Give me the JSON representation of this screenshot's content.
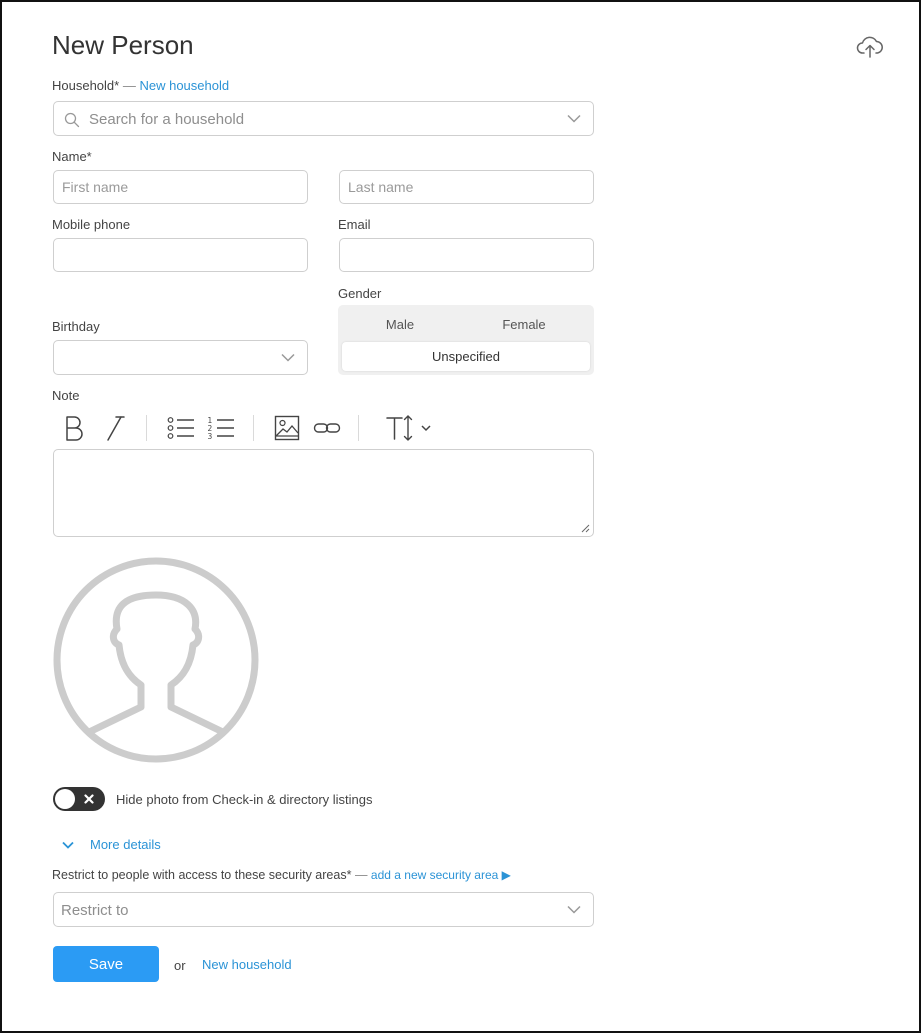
{
  "page": {
    "title": "New Person"
  },
  "household": {
    "label": "Household*",
    "separator": "—",
    "new_link": "New household",
    "placeholder": "Search for a household"
  },
  "name": {
    "label": "Name*",
    "first_placeholder": "First name",
    "last_placeholder": "Last name",
    "first_value": "",
    "last_value": ""
  },
  "contact": {
    "mobile_label": "Mobile phone",
    "email_label": "Email",
    "mobile_value": "",
    "email_value": ""
  },
  "gender": {
    "label": "Gender",
    "options": [
      "Male",
      "Female",
      "Unspecified"
    ],
    "selected": "Unspecified"
  },
  "birthday": {
    "label": "Birthday",
    "value": ""
  },
  "note": {
    "label": "Note",
    "toolbar": [
      "bold-icon",
      "italic-icon",
      "bulleted-list-icon",
      "numbered-list-icon",
      "image-icon",
      "link-icon",
      "text-size-icon"
    ]
  },
  "photo": {
    "hide_label": "Hide photo from Check-in & directory listings",
    "hide_enabled": false
  },
  "more_details": {
    "label": "More details"
  },
  "security": {
    "label": "Restrict to people with access to these security areas*",
    "separator": "—",
    "add_link": "add a new security area ▶",
    "placeholder": "Restrict to"
  },
  "actions": {
    "save_label": "Save",
    "or_text": "or",
    "new_household_link": "New household"
  },
  "colors": {
    "accent": "#2b93d6",
    "save_button": "#2b9bf4",
    "toggle_off": "#333333",
    "avatar": "#cccccc"
  }
}
